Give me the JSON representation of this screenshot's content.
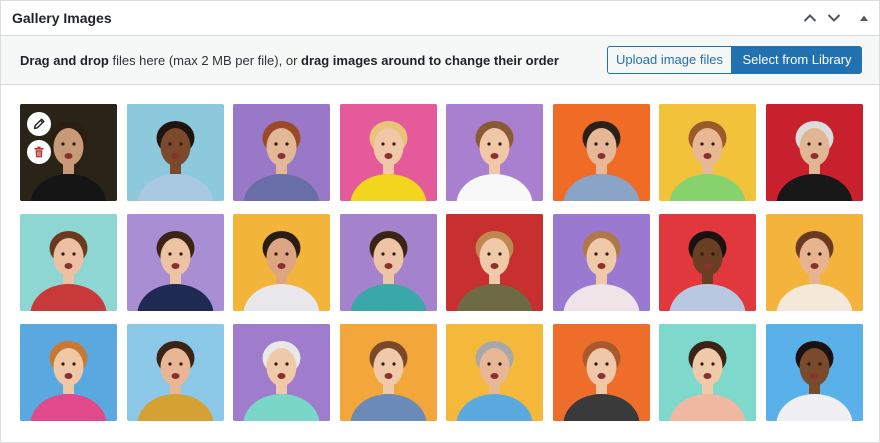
{
  "header": {
    "title": "Gallery Images",
    "controls": [
      "chevron-up-icon",
      "chevron-down-icon",
      "triangle-up-icon"
    ]
  },
  "toolbar": {
    "instructions": {
      "part1": "Drag and drop",
      "part2": " files here (max 2 MB per file), or ",
      "part3": "drag images around to change their order"
    },
    "upload_label": "Upload image files",
    "library_label": "Select from Library"
  },
  "colors": {
    "accent": "#2271b1",
    "border": "#dcdcde",
    "toolbar_bg": "#f6f7f7",
    "danger": "#b32d2e"
  },
  "gallery": {
    "first_item_actions": [
      "pencil-icon",
      "trash-icon"
    ],
    "items": [
      {
        "bg": "#2a2418",
        "shirt": "#151515",
        "skin": "#c89a78",
        "hair": "#2a1d12"
      },
      {
        "bg": "#8cc9dd",
        "shirt": "#a9c8e2",
        "skin": "#7b4a2c",
        "hair": "#1e1410"
      },
      {
        "bg": "#9a78c8",
        "shirt": "#6a6ea8",
        "skin": "#e2b896",
        "hair": "#9a4a26"
      },
      {
        "bg": "#e55a9a",
        "shirt": "#f2d51e",
        "skin": "#f0c8a8",
        "hair": "#e8c478"
      },
      {
        "bg": "#a97fd0",
        "shirt": "#f8f8f8",
        "skin": "#f0c8a8",
        "hair": "#8a5a32"
      },
      {
        "bg": "#ef6b26",
        "shirt": "#8aa4c8",
        "skin": "#e6b898",
        "hair": "#2a2018"
      },
      {
        "bg": "#f2c23a",
        "shirt": "#86d26c",
        "skin": "#e8b894",
        "hair": "#9a5a2a"
      },
      {
        "bg": "#c8202c",
        "shirt": "#181818",
        "skin": "#e2b694",
        "hair": "#dcdcdc"
      },
      {
        "bg": "#8ed6d2",
        "shirt": "#c83a3a",
        "skin": "#ecc0a0",
        "hair": "#6a3a20"
      },
      {
        "bg": "#a98ed4",
        "shirt": "#1e2a52",
        "skin": "#ecc4a4",
        "hair": "#3a2416"
      },
      {
        "bg": "#f3b43a",
        "shirt": "#e8e8ec",
        "skin": "#dca682",
        "hair": "#2a1e14"
      },
      {
        "bg": "#a482cc",
        "shirt": "#3aa8a8",
        "skin": "#eec4a6",
        "hair": "#3a2418"
      },
      {
        "bg": "#c83030",
        "shirt": "#6e6a44",
        "skin": "#f0caa8",
        "hair": "#c08850"
      },
      {
        "bg": "#9a7ad0",
        "shirt": "#f0e4e8",
        "skin": "#f0caa8",
        "hair": "#b07848"
      },
      {
        "bg": "#e0383c",
        "shirt": "#b8c8e0",
        "skin": "#6a3e22",
        "hair": "#1a1210"
      },
      {
        "bg": "#f4b43c",
        "shirt": "#f4e8d8",
        "skin": "#e8b490",
        "hair": "#6a3a20"
      },
      {
        "bg": "#5aa8e0",
        "shirt": "#e04a8a",
        "skin": "#f0c8a6",
        "hair": "#c87832"
      },
      {
        "bg": "#8cc8e8",
        "shirt": "#d4a232",
        "skin": "#e8b694",
        "hair": "#3a2416"
      },
      {
        "bg": "#a07ccc",
        "shirt": "#7ad6c6",
        "skin": "#f0caa8",
        "hair": "#e8e8e8"
      },
      {
        "bg": "#f3a63a",
        "shirt": "#6a8ab8",
        "skin": "#f0caa8",
        "hair": "#7a4a28"
      },
      {
        "bg": "#f4b83a",
        "shirt": "#5aaae0",
        "skin": "#e8b896",
        "hair": "#a8a8a8"
      },
      {
        "bg": "#ef6d2a",
        "shirt": "#3a3a3a",
        "skin": "#f0c8a8",
        "hair": "#a85a2c"
      },
      {
        "bg": "#7ed8cc",
        "shirt": "#f0b8a0",
        "skin": "#f0caa8",
        "hair": "#3a2418"
      },
      {
        "bg": "#5ab0e8",
        "shirt": "#f0f0f4",
        "skin": "#7a4a2c",
        "hair": "#1a1210"
      }
    ]
  }
}
